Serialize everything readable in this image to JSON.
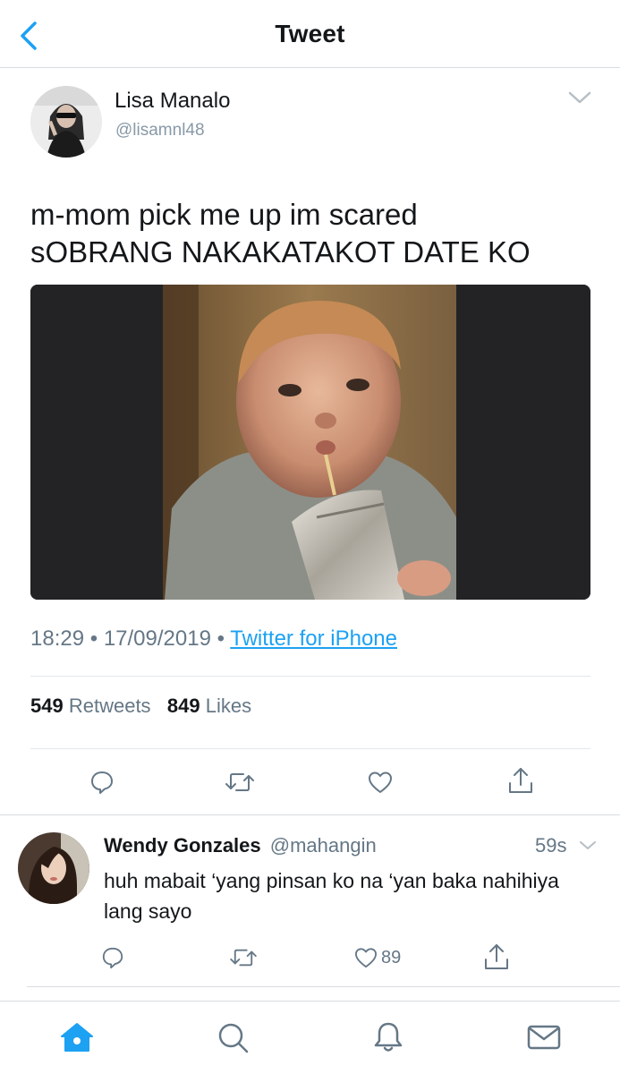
{
  "nav": {
    "title": "Tweet"
  },
  "tweet": {
    "author_name": "Lisa Manalo",
    "author_handle": "@lisamnl48",
    "text_line1": "m-mom pick me up im scared",
    "text_line2": "sOBRANG NAKAKATAKOT DATE KO",
    "time": "18:29",
    "date": "17/09/2019",
    "source": "Twitter for iPhone",
    "retweet_count": "549",
    "retweet_label": "Retweets",
    "like_count": "849",
    "like_label": "Likes"
  },
  "reply": {
    "author_name": "Wendy Gonzales",
    "author_handle": "@mahangin",
    "time": "59s",
    "text": "huh mabait ‘yang pinsan ko na ‘yan baka nahihiya lang sayo",
    "like_count": "89"
  },
  "colors": {
    "accent": "#1da1f2",
    "text_primary": "#14171a",
    "text_secondary": "#657786",
    "divider": "#e1e8ed"
  },
  "icons": {
    "back": "chevron-left-icon",
    "caret": "chevron-down-icon",
    "reply": "speech-bubble-icon",
    "retweet": "retweet-icon",
    "like": "heart-icon",
    "share": "share-icon",
    "home": "home-icon",
    "search": "search-icon",
    "notifications": "bell-icon",
    "messages": "envelope-icon"
  }
}
